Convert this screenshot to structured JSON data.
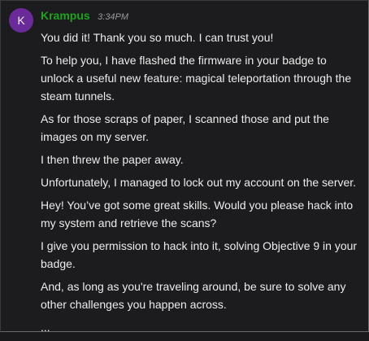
{
  "message": {
    "avatar_letter": "K",
    "avatar_color": "#6b2a9a",
    "author": "Krampus",
    "author_color": "#1fa31f",
    "timestamp": "3:34PM",
    "lines": [
      "You did it! Thank you so much. I can trust you!",
      "To help you, I have flashed the firmware in your badge to unlock a useful new feature: magical teleportation through the steam tunnels.",
      "As for those scraps of paper, I scanned those and put the images on my server.",
      "I then threw the paper away.",
      "Unfortunately, I managed to lock out my account on the server.",
      "Hey! You’ve got some great skills. Would you please hack into my system and retrieve the scans?",
      "I give you permission to hack into it, solving Objective 9 in your badge.",
      "And, as long as you're traveling around, be sure to solve any other challenges you happen across.",
      "..."
    ]
  }
}
